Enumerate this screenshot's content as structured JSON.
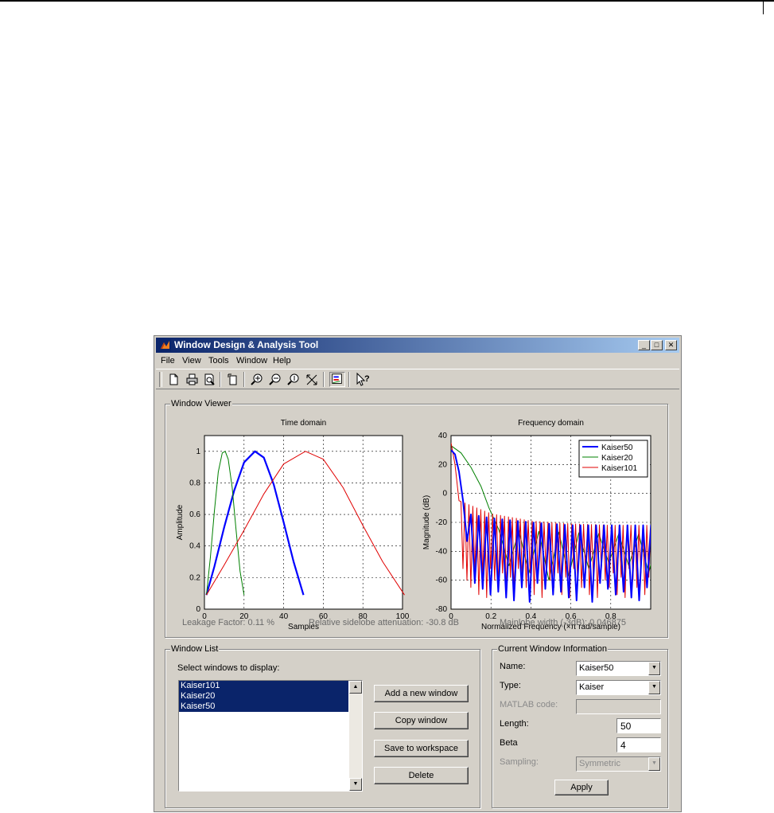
{
  "window": {
    "title": "Window Design & Analysis Tool",
    "controls": {
      "minimize": "_",
      "maximize": "□",
      "close": "✕"
    }
  },
  "menu": [
    "File",
    "View",
    "Tools",
    "Window",
    "Help"
  ],
  "toolbar": [
    "new-icon",
    "print-icon",
    "print-preview-icon",
    "full-view-icon",
    "zoom-in-icon",
    "zoom-x-icon",
    "zoom-y-icon",
    "full-view-x-icon",
    "legend-icon",
    "whats-this-icon"
  ],
  "viewer": {
    "label": "Window Viewer",
    "stats": {
      "leakage": "Leakage Factor: 0.11 %",
      "sidelobe": "Relative sidelobe attenuation: -30.8 dB",
      "mainlobe": "Mainlobe width (-3dB): 0.046875"
    }
  },
  "colors": {
    "kaiser50": "#0000ff",
    "kaiser20": "#008000",
    "kaiser101": "#e00000",
    "selection": "#0a246a"
  },
  "chart_data": [
    {
      "type": "line",
      "title": "Time domain",
      "xlabel": "Samples",
      "ylabel": "Amplitude",
      "xlim": [
        0,
        100
      ],
      "ylim": [
        0,
        1.1
      ],
      "xticks": [
        "0",
        "20",
        "40",
        "60",
        "80",
        "100"
      ],
      "yticks": [
        "0",
        "0.2",
        "0.4",
        "0.6",
        "0.8",
        "1"
      ],
      "grid": true,
      "series": [
        {
          "name": "Kaiser50",
          "color": "#0000ff",
          "width": 2.2,
          "x": [
            1,
            5,
            10,
            15,
            20,
            25.5,
            30,
            35,
            40,
            45,
            50
          ],
          "y": [
            0.09,
            0.27,
            0.52,
            0.75,
            0.93,
            1.0,
            0.96,
            0.79,
            0.55,
            0.3,
            0.09
          ]
        },
        {
          "name": "Kaiser20",
          "color": "#008000",
          "width": 1,
          "x": [
            1,
            3,
            5,
            7,
            9,
            10.5,
            12,
            14,
            16,
            18,
            20
          ],
          "y": [
            0.09,
            0.33,
            0.62,
            0.87,
            0.99,
            1.0,
            0.95,
            0.77,
            0.5,
            0.24,
            0.09
          ]
        },
        {
          "name": "Kaiser101",
          "color": "#e00000",
          "width": 1,
          "x": [
            1,
            10,
            20,
            30,
            40,
            51,
            60,
            70,
            80,
            90,
            101
          ],
          "y": [
            0.09,
            0.28,
            0.5,
            0.73,
            0.92,
            1.0,
            0.95,
            0.77,
            0.53,
            0.3,
            0.09
          ]
        }
      ]
    },
    {
      "type": "line",
      "title": "Frequency domain",
      "xlabel": "Normalized Frequency  (×π rad/sample)",
      "ylabel": "Magnitude (dB)",
      "xlim": [
        0,
        1
      ],
      "ylim": [
        -80,
        40
      ],
      "xticks": [
        "0",
        "0.2",
        "0.4",
        "0.6",
        "0.8"
      ],
      "yticks": [
        "40",
        "20",
        "0",
        "-20",
        "-40",
        "-60",
        "-80"
      ],
      "grid": true,
      "legend": {
        "placement": "top-right",
        "entries": [
          "Kaiser50",
          "Kaiser20",
          "Kaiser101"
        ]
      },
      "series": [
        {
          "name": "Kaiser50",
          "color": "#0000ff",
          "width": 2,
          "main": {
            "x": [
              0,
              0.02,
              0.04,
              0.06,
              0.08
            ],
            "y": [
              30,
              27,
              15,
              -5,
              -33
            ]
          },
          "envelope": {
            "x": [
              0.08,
              0.2,
              0.4,
              0.6,
              0.8,
              1.0
            ],
            "y": [
              -14,
              -17,
              -20,
              -22,
              -22,
              -22
            ]
          },
          "period": 0.0392,
          "dips": [
            -62,
            -66,
            -70,
            -68,
            -72,
            -74,
            -65,
            -75
          ]
        },
        {
          "name": "Kaiser20",
          "color": "#008000",
          "width": 1,
          "main": {
            "x": [
              0,
              0.05,
              0.1,
              0.15,
              0.19
            ],
            "y": [
              33,
              28,
              18,
              5,
              -10
            ]
          },
          "envelope": {
            "x": [
              0.19,
              0.4,
              0.6,
              0.8,
              1.0
            ],
            "y": [
              -25,
              -26,
              -27,
              -28,
              -28
            ]
          },
          "period": 0.1,
          "dips": [
            -50,
            -55,
            -60,
            -57,
            -52,
            -48
          ]
        },
        {
          "name": "Kaiser101",
          "color": "#e00000",
          "width": 1,
          "main": {
            "x": [
              0,
              0.02,
              0.04
            ],
            "y": [
              35,
              20,
              -5
            ]
          },
          "envelope": {
            "x": [
              0.04,
              0.2,
              0.4,
              0.6,
              0.8,
              1.0
            ],
            "y": [
              -5,
              -14,
              -19,
              -21,
              -22,
              -22
            ]
          },
          "period": 0.0198,
          "dips": [
            -52,
            -60,
            -65,
            -55,
            -70,
            -58,
            -72
          ]
        }
      ]
    }
  ],
  "window_list": {
    "label": "Window List",
    "prompt": "Select windows to display:",
    "items": [
      "Kaiser101",
      "Kaiser20",
      "Kaiser50"
    ],
    "buttons": {
      "add": "Add a new window",
      "copy": "Copy window",
      "save": "Save to workspace",
      "delete": "Delete"
    }
  },
  "info": {
    "label": "Current Window Information",
    "name_label": "Name:",
    "name_value": "Kaiser50",
    "type_label": "Type:",
    "type_value": "Kaiser",
    "matlab_label": "MATLAB code:",
    "matlab_value": "",
    "length_label": "Length:",
    "length_value": "50",
    "beta_label": "Beta",
    "beta_value": "4",
    "sampling_label": "Sampling:",
    "sampling_value": "Symmetric",
    "apply": "Apply"
  }
}
